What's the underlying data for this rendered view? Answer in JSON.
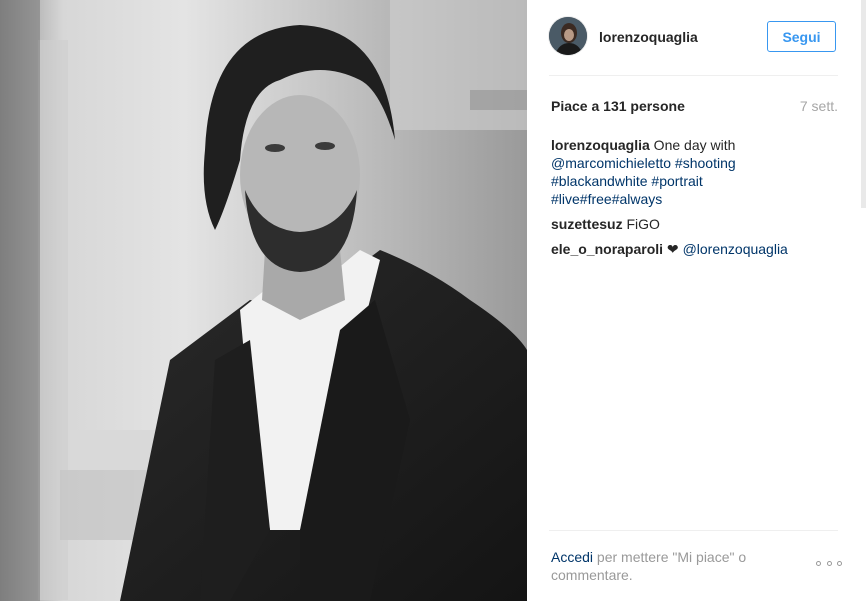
{
  "post": {
    "username": "lorenzoquaglia",
    "follow_label": "Segui",
    "likes_text": "Piace a 131 persone",
    "timestamp": "7 sett.",
    "comments": [
      {
        "author": "lorenzoquaglia",
        "parts": [
          {
            "text": " One day with "
          },
          {
            "text": "@marcomichieletto",
            "link": true
          },
          {
            "text": " "
          },
          {
            "text": "#shooting",
            "link": true
          },
          {
            "text": " "
          },
          {
            "text": "#blackandwhite",
            "link": true
          },
          {
            "text": " "
          },
          {
            "text": "#portrait",
            "link": true
          },
          {
            "text": " "
          },
          {
            "text": "#live",
            "link": true
          },
          {
            "text": "#free",
            "link": true
          },
          {
            "text": "#always",
            "link": true
          }
        ]
      },
      {
        "author": "suzettesuz",
        "parts": [
          {
            "text": " FiGO"
          }
        ]
      },
      {
        "author": "ele_o_noraparoli",
        "parts": [
          {
            "text": " ❤ "
          },
          {
            "text": "@lorenzoquaglia",
            "link": true
          }
        ]
      }
    ],
    "footer": {
      "login_label": "Accedi",
      "rest_text": " per mettere \"Mi piace\" o commentare."
    }
  },
  "icons": {
    "more": "more-options-icon"
  }
}
